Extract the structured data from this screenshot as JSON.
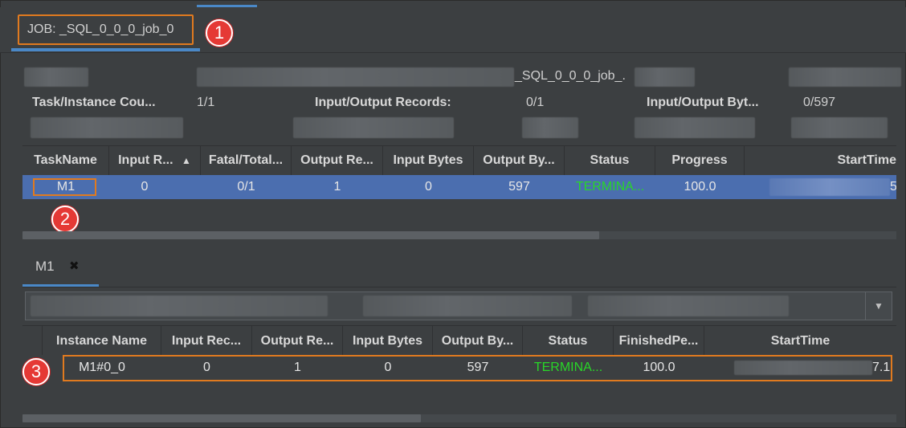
{
  "job_tab": {
    "label": "JOB: _SQL_0_0_0_job_0"
  },
  "callouts": [
    "1",
    "2",
    "3"
  ],
  "summary": {
    "job_name_fragment": "_SQL_0_0_0_job_.",
    "task_instance_count_label": "Task/Instance Cou...",
    "task_instance_count_value": "1/1",
    "io_records_label": "Input/Output Records:",
    "io_records_value": "0/1",
    "io_bytes_label": "Input/Output Byt...",
    "io_bytes_value": "0/597"
  },
  "task_table": {
    "columns": [
      "TaskName",
      "Input R...",
      "Fatal/Total...",
      "Output Re...",
      "Input Bytes",
      "Output By...",
      "Status",
      "Progress",
      "StartTime"
    ],
    "sort_indicator": "▲",
    "rows": [
      {
        "task_name": "M1",
        "input_records": "0",
        "fatal_total": "0/1",
        "output_records": "1",
        "input_bytes": "0",
        "output_bytes": "597",
        "status": "TERMINA...",
        "progress": "100.0",
        "start_time_tail": "5"
      }
    ]
  },
  "instance_tab": {
    "label": "M1",
    "close_glyph": "✖"
  },
  "filter": {
    "dropdown_glyph": "▼"
  },
  "instance_table": {
    "columns": [
      "Instance Name",
      "Input Rec...",
      "Output Re...",
      "Input Bytes",
      "Output By...",
      "Status",
      "FinishedPe...",
      "StartTime"
    ],
    "rows": [
      {
        "instance_name": "M1#0_0",
        "input_records": "0",
        "output_records": "1",
        "input_bytes": "0",
        "output_bytes": "597",
        "status": "TERMINA...",
        "finished_percent": "100.0",
        "start_time_tail": "7.1"
      }
    ]
  },
  "colors": {
    "accent": "#4a88c7",
    "highlight_box": "#e07a1f",
    "status_green": "#28d628",
    "selected_row": "#4b6eaf",
    "callout_red": "#e53935"
  }
}
